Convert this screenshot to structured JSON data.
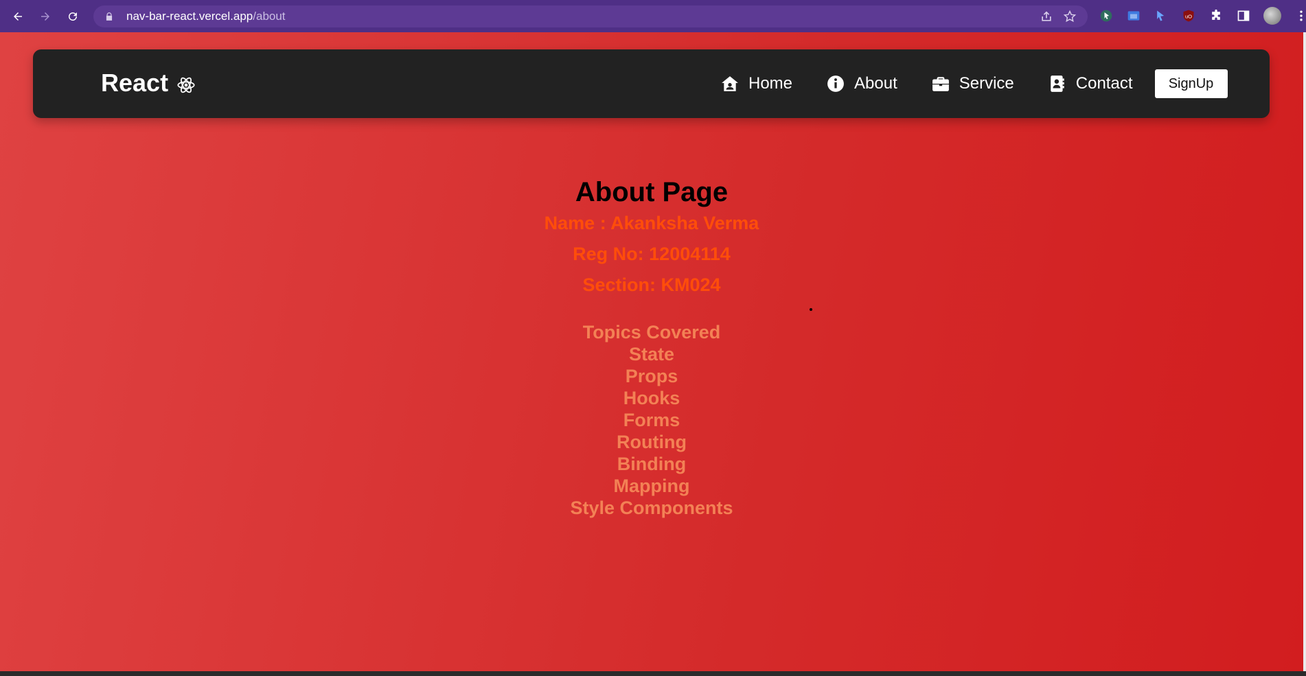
{
  "browser": {
    "url_host": "nav-bar-react.vercel.app",
    "url_path": "/about"
  },
  "navbar": {
    "brand": "React",
    "links": [
      {
        "label": "Home",
        "icon": "home-icon"
      },
      {
        "label": "About",
        "icon": "info-icon"
      },
      {
        "label": "Service",
        "icon": "briefcase-icon"
      },
      {
        "label": "Contact",
        "icon": "contact-card-icon"
      }
    ],
    "signup_label": "SignUp"
  },
  "main": {
    "title": "About Page",
    "name": "Name : Akanksha Verma",
    "reg_no": "Reg No: 12004114",
    "section": "Section: KM024",
    "topics_heading": "Topics Covered",
    "topics": [
      "State",
      "Props",
      "Hooks",
      "Forms",
      "Routing",
      "Binding",
      "Mapping",
      "Style Components"
    ]
  },
  "colors": {
    "navbar_bg": "#222222",
    "page_gradient_start": "#df4242",
    "page_gradient_end": "#d21d1f",
    "info_text": "#ff4d0a",
    "topics_text": "#f38155",
    "browser_frame": "#4f2f86"
  }
}
